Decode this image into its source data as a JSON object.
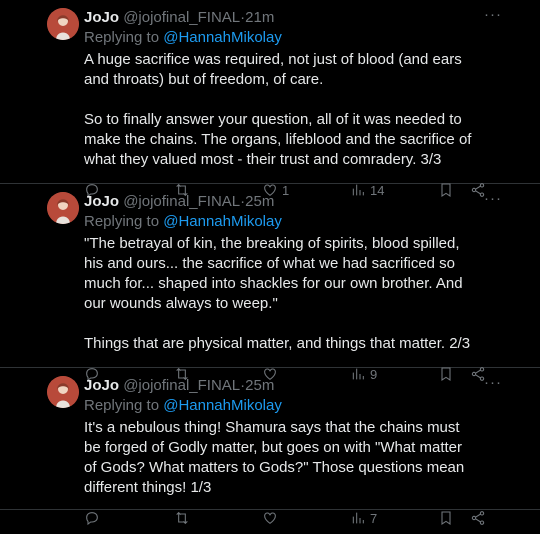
{
  "tweets": [
    {
      "name": "JoJo",
      "handle": "@jojofinal_FINAL",
      "time": "21m",
      "reply_prefix": "Replying to",
      "reply_to": "@HannahMikolay",
      "paragraphs": [
        "A huge sacrifice was required, not just of blood (and ears and throats) but of freedom, of care.",
        "So to finally answer your question, all of it was needed to make the chains. The organs, lifeblood and the sacrifice of what they valued most - their trust and comradery. 3/3"
      ],
      "likes": "1",
      "views": "14"
    },
    {
      "name": "JoJo",
      "handle": "@jojofinal_FINAL",
      "time": "25m",
      "reply_prefix": "Replying to",
      "reply_to": "@HannahMikolay",
      "paragraphs": [
        "\"The betrayal of kin, the breaking of spirits, blood spilled, his and ours... the sacrifice of what we had sacrificed so much for... shaped into shackles for our own brother. And our wounds always to weep.\"",
        "Things that are physical matter, and things that matter. 2/3"
      ],
      "likes": "",
      "views": "9"
    },
    {
      "name": "JoJo",
      "handle": "@jojofinal_FINAL",
      "time": "25m",
      "reply_prefix": "Replying to",
      "reply_to": "@HannahMikolay",
      "paragraphs": [
        "It's a nebulous thing! Shamura says that the chains must be forged of Godly matter, but goes on with \"What matter of Gods? What matters to Gods?\" Those questions mean different things! 1/3"
      ],
      "likes": "",
      "views": "7"
    }
  ],
  "separator": "·",
  "more_glyph": "···",
  "icons": [
    "more-icon",
    "reply-icon",
    "retweet-icon",
    "like-icon",
    "views-icon",
    "bookmark-icon",
    "share-icon"
  ],
  "colors": {
    "background": "#000000",
    "text": "#e7e9ea",
    "muted": "#71767b",
    "link": "#1d9bf0",
    "divider": "#2f3336"
  }
}
